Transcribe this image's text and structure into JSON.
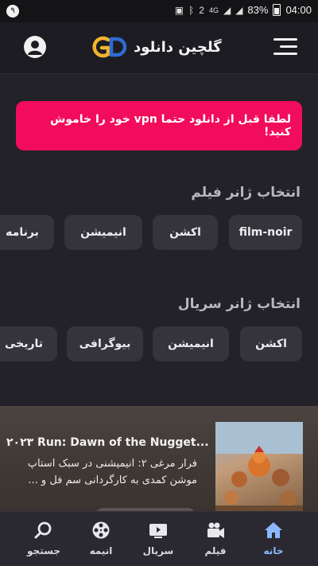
{
  "status_bar": {
    "notification_badge": "۹",
    "battery_percent": "83%",
    "time": "04:00",
    "sim_label": "2",
    "network_label": "4G"
  },
  "header": {
    "logo_text": "گلچین دانلود",
    "logo_mark": "GD"
  },
  "vpn_notice": "لطفا قبل از دانلود حتما vpn خود را خاموش کنید!",
  "movie_genres": {
    "title": "انتخاب ژانر فیلم",
    "items": [
      "film-noir",
      "اکشن",
      "انیمیشن",
      "برنامه"
    ]
  },
  "series_genres": {
    "title": "انتخاب ژانر سریال",
    "items": [
      "اکشن",
      "انیمیشن",
      "بیوگرافی",
      "تاریخی"
    ]
  },
  "featured": {
    "title": "۲۰۲۳ Run: Dawn of the Nugget...",
    "description": "فرار مرغی ۲: انیمیشنی در سبک استاپ موشن کمدی به کارگردانی سم فل و ..."
  },
  "bottom_nav": {
    "items": [
      {
        "label": "خانه",
        "icon": "home-icon",
        "active": true
      },
      {
        "label": "فیلم",
        "icon": "video-camera-icon",
        "active": false
      },
      {
        "label": "سریال",
        "icon": "tv-play-icon",
        "active": false
      },
      {
        "label": "انیمه",
        "icon": "film-reel-icon",
        "active": false
      },
      {
        "label": "جستجو",
        "icon": "search-icon",
        "active": false
      }
    ]
  },
  "colors": {
    "accent": "#f20c5c",
    "background": "#232229",
    "chip": "#35343b",
    "active_nav": "#8bb8ff"
  }
}
